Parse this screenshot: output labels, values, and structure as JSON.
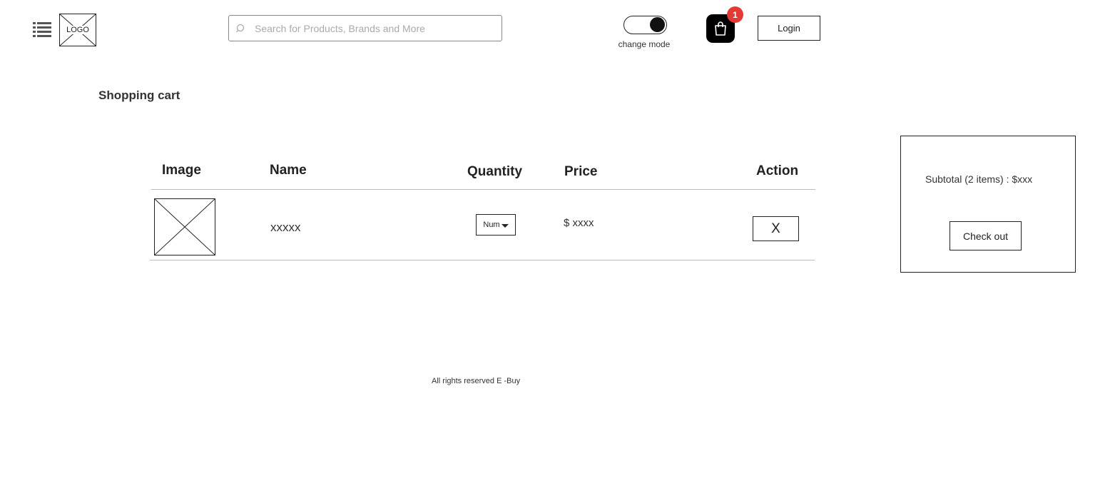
{
  "header": {
    "menu_icon": "list-icon",
    "logo_text": "LOGO",
    "search": {
      "placeholder": "Search for Products, Brands and More",
      "value": ""
    },
    "mode_toggle": {
      "label": "change mode",
      "state": "on"
    },
    "cart": {
      "icon": "shopping-bag-icon",
      "badge_count": "1"
    },
    "login_label": "Login"
  },
  "page_title": "Shopping cart",
  "table": {
    "headers": [
      "Image",
      "Name",
      "Quantity",
      "Price",
      "Action"
    ],
    "rows": [
      {
        "name": "xxxxx",
        "quantity_label": "Num",
        "price": "$ xxxx",
        "action_label": "X"
      }
    ]
  },
  "summary": {
    "subtotal_text": "Subtotal (2 items) : $xxx",
    "checkout_label": "Check out"
  },
  "footer": {
    "text": "All rights reserved E -Buy"
  },
  "colors": {
    "badge": "#e53935",
    "cart_button": "#000000",
    "border": "#222222"
  }
}
